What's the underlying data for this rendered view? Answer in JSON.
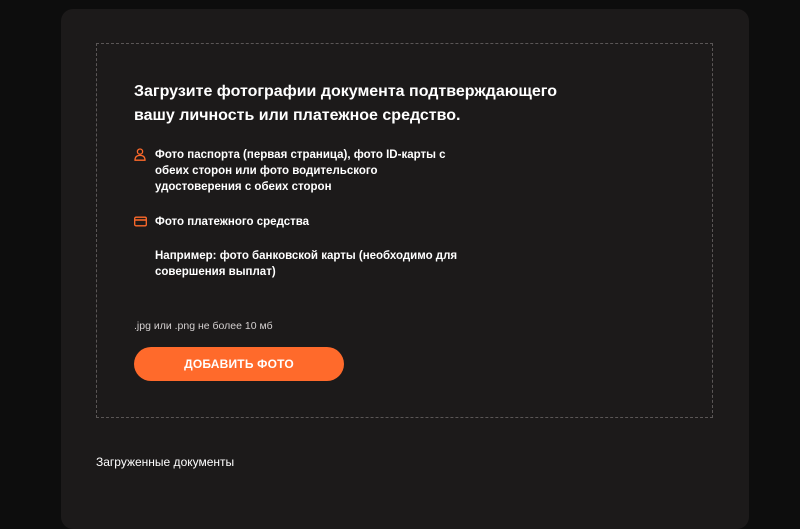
{
  "upload": {
    "title": "Загрузите фотографии документа подтверждающего вашу личность или платежное средство.",
    "items": [
      {
        "icon": "person-icon",
        "text": "Фото паспорта (первая страница), фото ID-карты с обеих сторон или фото водительского удостоверения с обеих сторон"
      },
      {
        "icon": "credit-card-icon",
        "text": "Фото платежного средства"
      }
    ],
    "example": "Например: фото банковской карты (необходимо для совершения выплат)",
    "format_hint": ".jpg или .png не более 10 мб",
    "add_button_label": "ДОБАВИТЬ ФОТО"
  },
  "uploaded_documents": {
    "title": "Загруженные документы"
  },
  "colors": {
    "accent": "#ff6a2b",
    "panel": "#1c1a1a",
    "background": "#0d0d0d"
  }
}
